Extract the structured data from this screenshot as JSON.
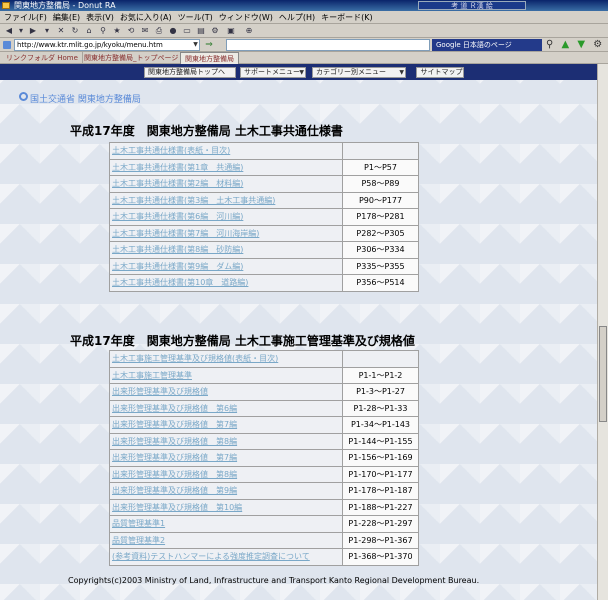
{
  "window": {
    "title": "関東地方整備局 - Donut RA",
    "tray_text": "考 道 Ｒ漢 絵"
  },
  "menu": [
    "ファイル(F)",
    "編集(E)",
    "表示(V)",
    "お気に入り(A)",
    "ツール(T)",
    "ウィンドウ(W)",
    "ヘルプ(H)",
    "キーボード(K)"
  ],
  "address": {
    "url": "http://www.ktr.mlit.go.jp/kyoku/menu.htm",
    "search_label": "Google 日本語のページ"
  },
  "links_tabs": [
    "リンクフォルダ Home",
    "関東地方整備局_トップページ",
    "関東地方整備局"
  ],
  "sitebar": {
    "top_button": "関東地方整備局トップへ",
    "support_menu": "サポートメニュー",
    "category_menu": "カテゴリー別メニュー",
    "sitemap": "サイトマップ"
  },
  "ministry": "国土交通省 関東地方整備局",
  "section1": {
    "title": "平成17年度　関東地方整備局 土木工事共通仕様書",
    "rows": [
      {
        "item": "土木工事共通仕様書(表紙・目次)",
        "pages": ""
      },
      {
        "item": "土木工事共通仕様書(第1章　共通編)",
        "pages": "P1〜P57"
      },
      {
        "item": "土木工事共通仕様書(第2編　材料編)",
        "pages": "P58〜P89"
      },
      {
        "item": "土木工事共通仕様書(第3編　土木工事共通編)",
        "pages": "P90〜P177"
      },
      {
        "item": "土木工事共通仕様書(第6編　河川編)",
        "pages": "P178〜P281"
      },
      {
        "item": "土木工事共通仕様書(第7編　河川海岸編)",
        "pages": "P282〜P305"
      },
      {
        "item": "土木工事共通仕様書(第8編　砂防編)",
        "pages": "P306〜P334"
      },
      {
        "item": "土木工事共通仕様書(第9編　ダム編)",
        "pages": "P335〜P355"
      },
      {
        "item": "土木工事共通仕様書(第10章　道路編)",
        "pages": "P356〜P514"
      }
    ]
  },
  "section2": {
    "title": "平成17年度　関東地方整備局 土木工事施工管理基準及び規格値",
    "rows": [
      {
        "item": "土木工事施工管理基準及び規格値(表紙・目次)",
        "pages": ""
      },
      {
        "item": "土木工事施工管理基準",
        "pages": "P1-1〜P1-2"
      },
      {
        "item": "出来形管理基準及び規格値",
        "pages": "P1-3〜P1-27"
      },
      {
        "item": "出来形管理基準及び規格値　第6編",
        "pages": "P1-28〜P1-33"
      },
      {
        "item": "出来形管理基準及び規格値　第7編",
        "pages": "P1-34〜P1-143"
      },
      {
        "item": "出来形管理基準及び規格値　第8編",
        "pages": "P1-144〜P1-155"
      },
      {
        "item": "出来形管理基準及び規格値　第7編",
        "pages": "P1-156〜P1-169"
      },
      {
        "item": "出来形管理基準及び規格値　第8編",
        "pages": "P1-170〜P1-177"
      },
      {
        "item": "出来形管理基準及び規格値　第9編",
        "pages": "P1-178〜P1-187"
      },
      {
        "item": "出来形管理基準及び規格値　第10編",
        "pages": "P1-188〜P1-227"
      },
      {
        "item": "品質管理基準1",
        "pages": "P1-228〜P1-297"
      },
      {
        "item": "品質管理基準2",
        "pages": "P1-298〜P1-367"
      },
      {
        "item": "(参考資料)テストハンマーによる強度推定調査について",
        "pages": "P1-368〜P1-370"
      }
    ]
  },
  "footer": "Copyrights(c)2003 Ministry of Land, Infrastructure and Transport Kanto Regional Development Bureau."
}
